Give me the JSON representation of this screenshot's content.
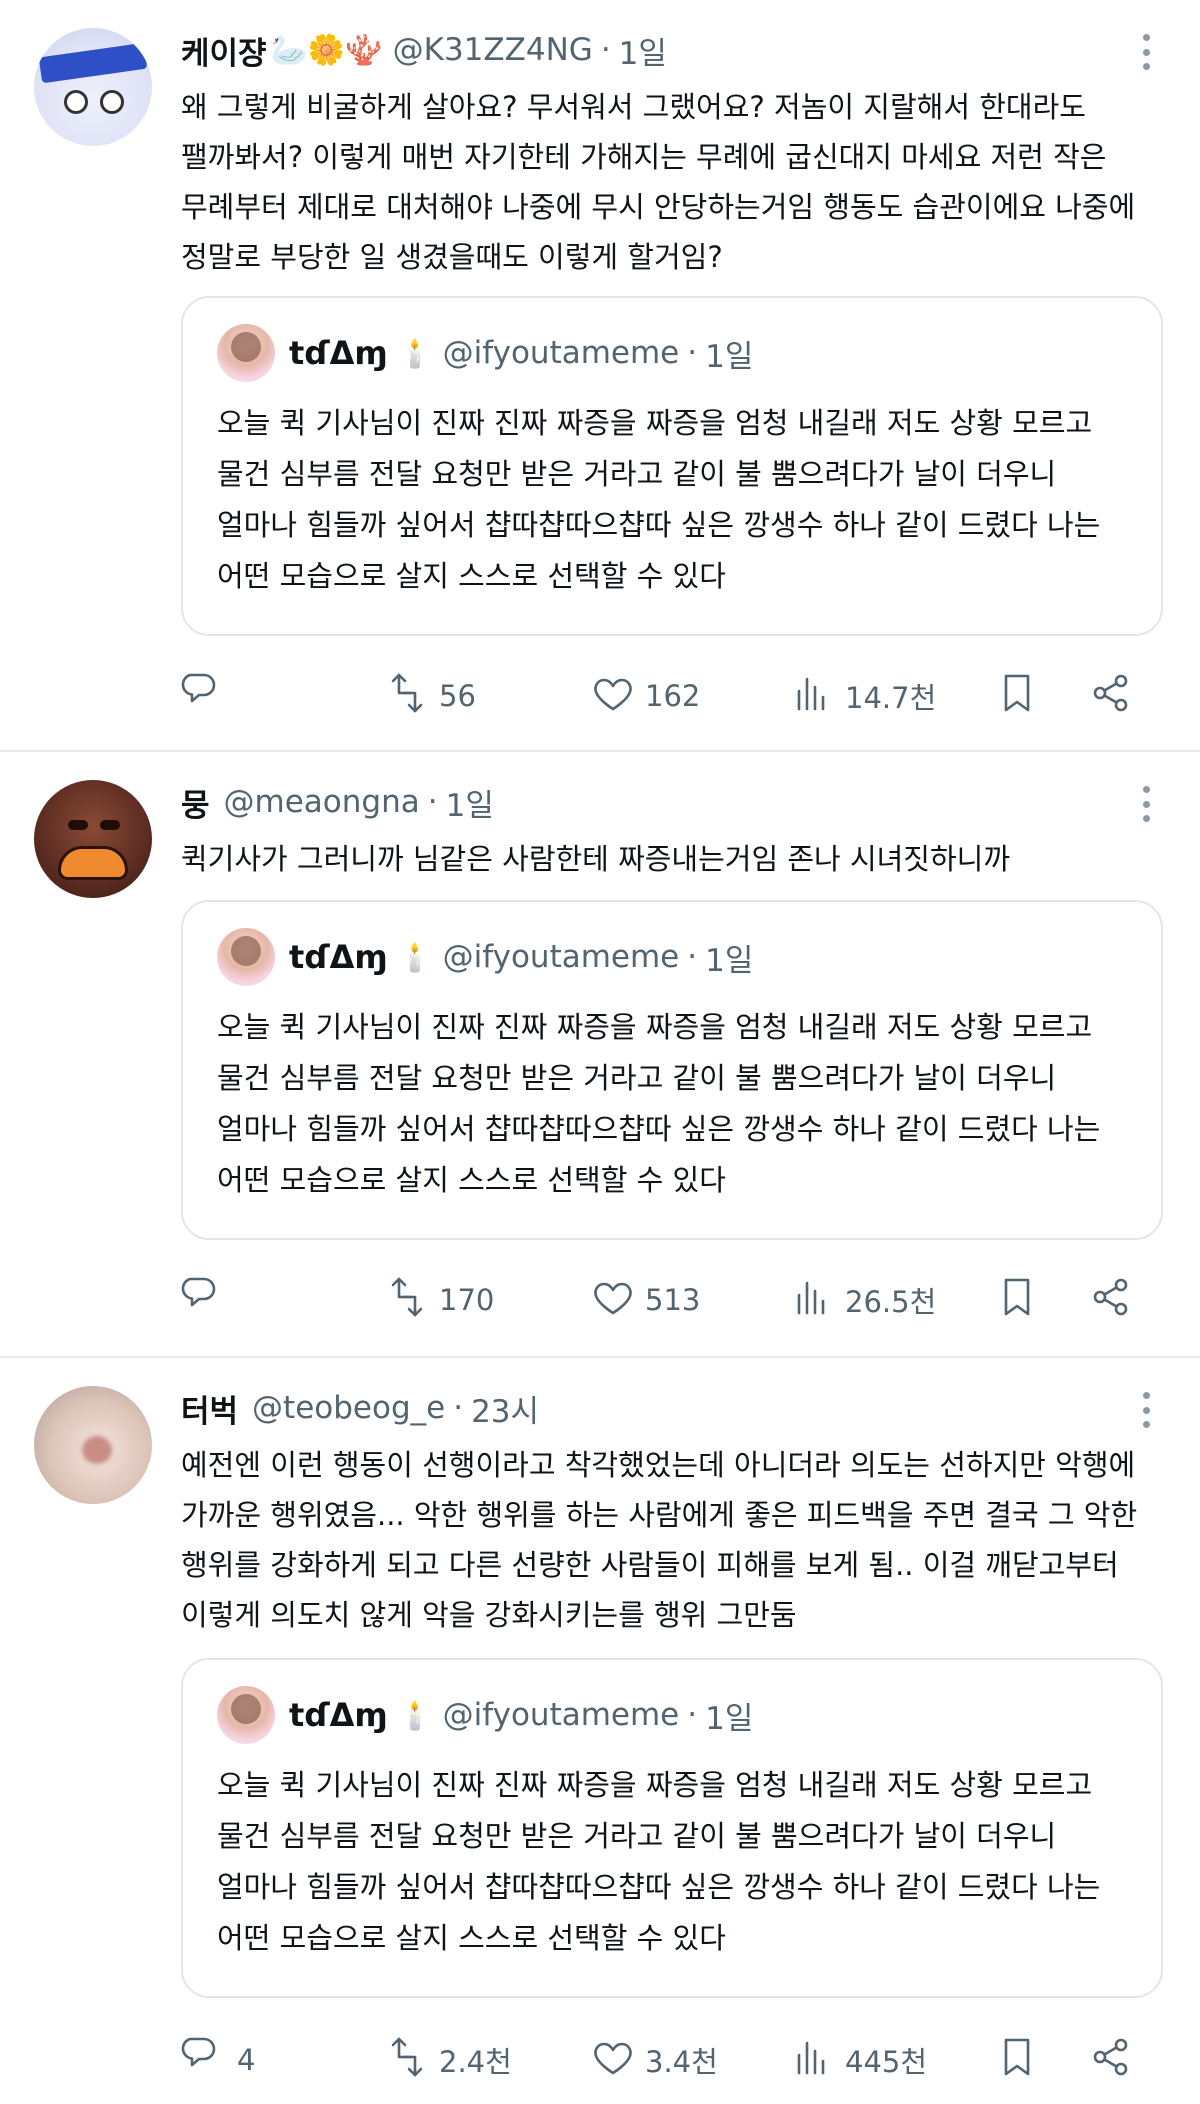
{
  "quoted": {
    "name": "tɗΔɱ",
    "candle": "🕯️",
    "handle": "@ifyoutameme",
    "time": "1일",
    "text": "오늘 퀵 기사님이 진짜 진짜 짜증을 짜증을 엄청 내길래 저도 상황 모르고\n물건 심부름 전달 요청만 받은 거라고 같이 불 뿜으려다가 날이 더우니\n얼마나 힘들까 싶어서 챱따챱따으챱따 싶은 깡생수 하나 같이 드렸다 나는\n어떤 모습으로 살지 스스로 선택할 수 있다"
  },
  "tweets": [
    {
      "name": "케이쟝",
      "emoji": "🦢🌼🪸",
      "handle": "@K31ZZ4NG",
      "time": "1일",
      "text": "왜 그렇게 비굴하게 살아요? 무서워서 그랬어요? 저놈이 지랄해서 한대라도\n팰까봐서? 이렇게 매번 자기한테 가해지는 무례에 굽신대지 마세요 저런 작은\n무례부터 제대로 대처해야 나중에 무시 안당하는거임 행동도 습관이에요 나중에\n정말로 부당한 일 생겼을때도 이렇게 할거임?",
      "replies": "",
      "retweets": "56",
      "likes": "162",
      "views": "14.7천"
    },
    {
      "name": "뭉",
      "emoji": "",
      "handle": "@meaongna",
      "time": "1일",
      "text": "퀵기사가 그러니까 님같은 사람한테 짜증내는거임 존나 시녀짓하니까",
      "replies": "",
      "retweets": "170",
      "likes": "513",
      "views": "26.5천"
    },
    {
      "name": "터벅",
      "emoji": "",
      "handle": "@teobeog_e",
      "time": "23시",
      "text": "예전엔 이런 행동이 선행이라고 착각했었는데 아니더라 의도는 선하지만 악행에\n가까운 행위였음... 악한 행위를 하는 사람에게 좋은 피드백을 주면 결국 그 악한\n행위를 강화하게 되고 다른 선량한 사람들이 피해를 보게 됨.. 이걸 깨닫고부터\n이렇게 의도치 않게 악을 강화시키는를 행위 그만둠",
      "replies": "4",
      "retweets": "2.4천",
      "likes": "3.4천",
      "views": "445천"
    }
  ],
  "icons": {
    "reply": "reply-icon",
    "retweet": "retweet-icon",
    "like": "heart-icon",
    "views": "views-icon",
    "bookmark": "bookmark-icon",
    "share": "share-icon"
  },
  "colors": {
    "text": "#0f1419",
    "secondary": "#536471",
    "border": "#e1e6ea"
  }
}
